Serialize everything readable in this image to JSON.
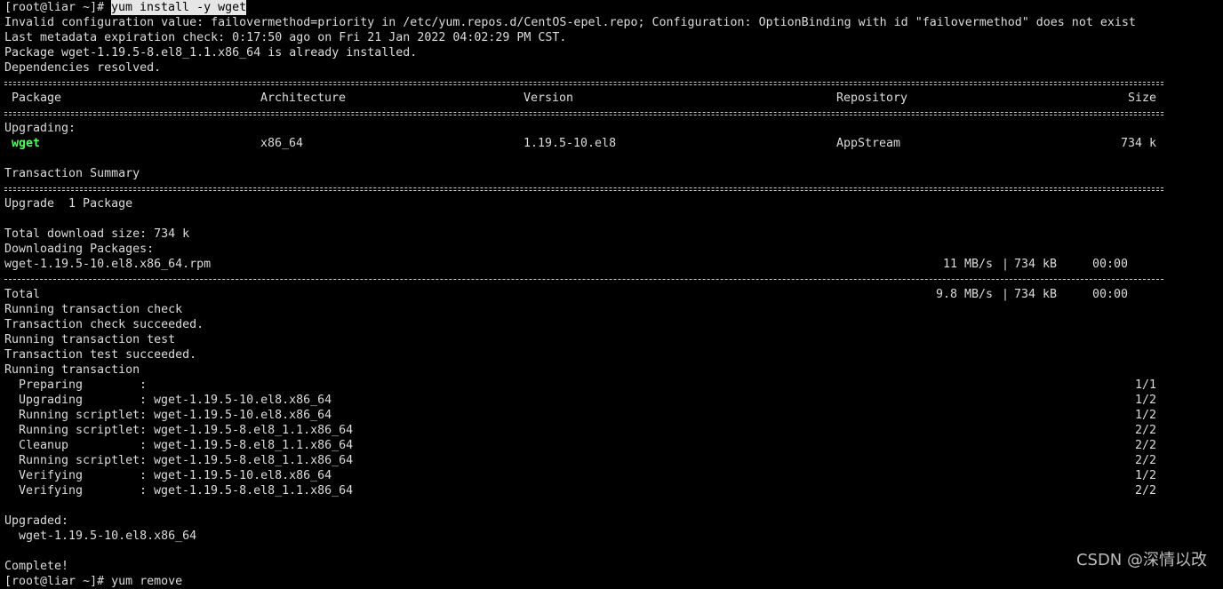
{
  "prompt": {
    "user_host": "[root@liar ~]# ",
    "command": "yum install -y wget"
  },
  "lines": {
    "invalid_config": "Invalid configuration value: failovermethod=priority in /etc/yum.repos.d/CentOS-epel.repo; Configuration: OptionBinding with id \"failovermethod\" does not exist",
    "metadata": "Last metadata expiration check: 0:17:50 ago on Fri 21 Jan 2022 04:02:29 PM CST.",
    "already_installed": "Package wget-1.19.5-8.el8_1.1.x86_64 is already installed.",
    "deps_resolved": "Dependencies resolved."
  },
  "table": {
    "headers": [
      "Package",
      "Architecture",
      "Version",
      "Repository",
      "Size"
    ],
    "section_label": "Upgrading:",
    "row": {
      "package": "wget",
      "arch": "x86_64",
      "version": "1.19.5-10.el8",
      "repo": "AppStream",
      "size": "734 k"
    }
  },
  "summary": {
    "title": "Transaction Summary",
    "upgrade_line": "Upgrade  1 Package",
    "total_download": "Total download size: 734 k",
    "downloading": "Downloading Packages:"
  },
  "download": {
    "file": {
      "name": "wget-1.19.5-10.el8.x86_64.rpm",
      "speed": "11 MB/s",
      "size": "734 kB",
      "time": "00:00"
    },
    "total": {
      "name": "Total",
      "speed": "9.8 MB/s",
      "size": "734 kB",
      "time": "00:00"
    },
    "separator": "|"
  },
  "transaction": {
    "check": "Running transaction check",
    "check_ok": "Transaction check succeeded.",
    "test": "Running transaction test",
    "test_ok": "Transaction test succeeded.",
    "running": "Running transaction",
    "steps": [
      {
        "action": "Preparing",
        "target": "",
        "count": "1/1"
      },
      {
        "action": "Upgrading",
        "target": "wget-1.19.5-10.el8.x86_64",
        "count": "1/2"
      },
      {
        "action": "Running scriptlet",
        "target": "wget-1.19.5-10.el8.x86_64",
        "count": "1/2"
      },
      {
        "action": "Running scriptlet",
        "target": "wget-1.19.5-8.el8_1.1.x86_64",
        "count": "2/2"
      },
      {
        "action": "Cleanup",
        "target": "wget-1.19.5-8.el8_1.1.x86_64",
        "count": "2/2"
      },
      {
        "action": "Running scriptlet",
        "target": "wget-1.19.5-8.el8_1.1.x86_64",
        "count": "2/2"
      },
      {
        "action": "Verifying",
        "target": "wget-1.19.5-10.el8.x86_64",
        "count": "1/2"
      },
      {
        "action": "Verifying",
        "target": "wget-1.19.5-8.el8_1.1.x86_64",
        "count": "2/2"
      }
    ],
    "step_colon": ":"
  },
  "result": {
    "upgraded_label": "Upgraded:",
    "upgraded_pkg": "  wget-1.19.5-10.el8.x86_64",
    "complete": "Complete!",
    "next_prompt": "[root@liar ~]# yum remove"
  },
  "watermark": "CSDN @深情以改"
}
